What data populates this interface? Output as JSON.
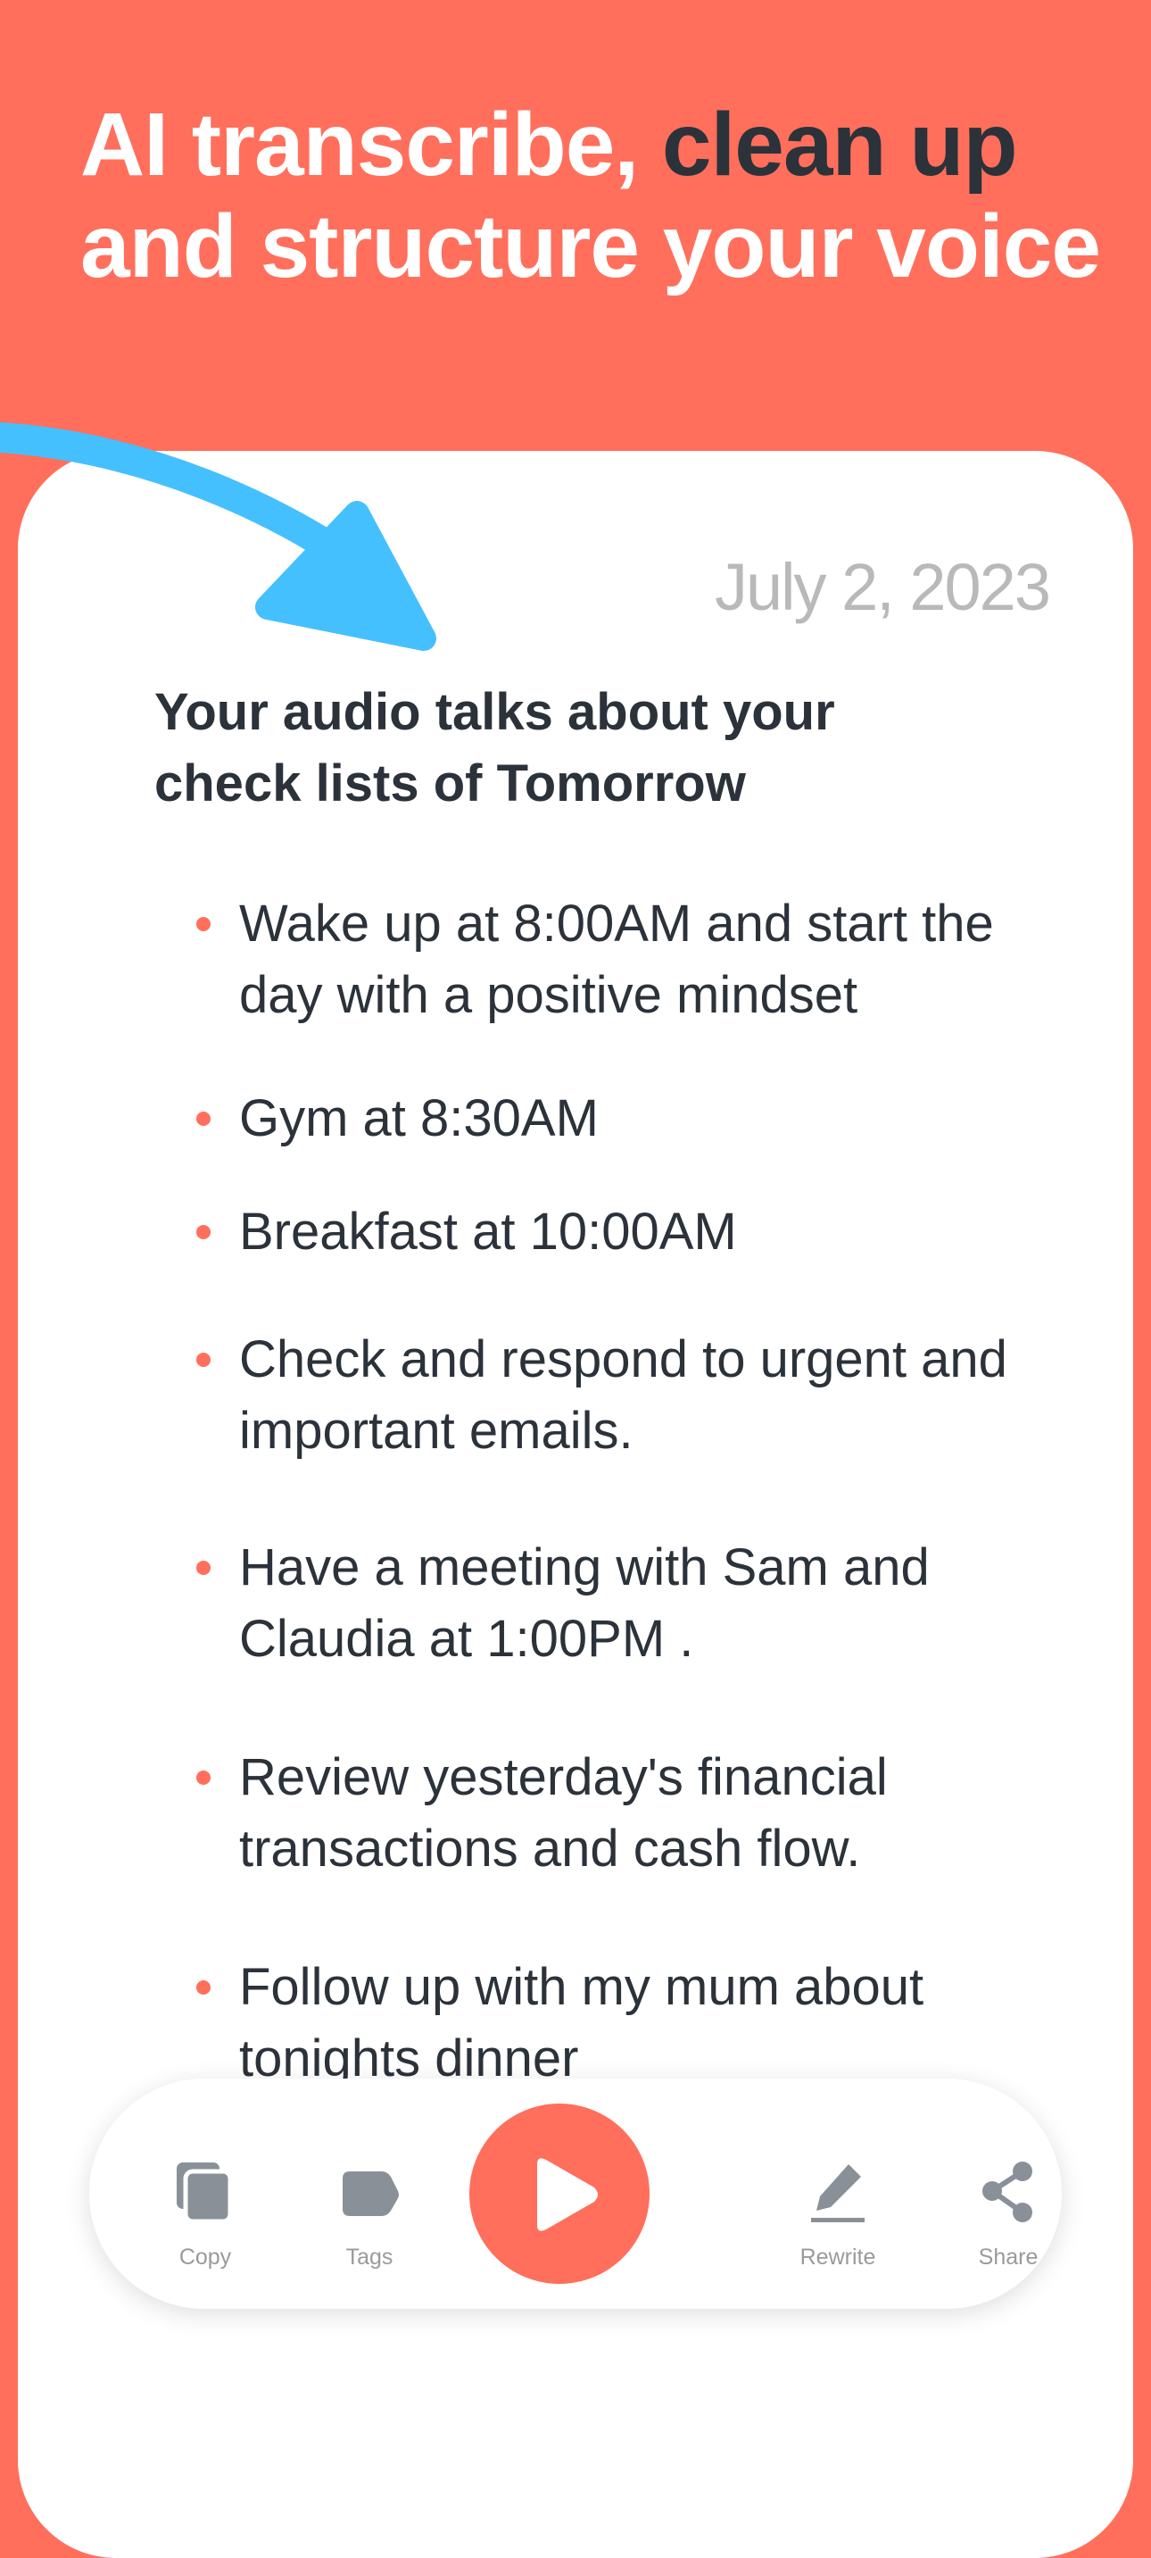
{
  "header": {
    "headline_part1": "AI transcribe, ",
    "headline_highlight": "clean up",
    "headline_part2": " and structure your voice"
  },
  "note": {
    "date": "July 2, 2023",
    "summary": "Your audio talks about your check lists of Tomorrow",
    "items": [
      "Wake up at 8:00AM and start the day with a positive mindset",
      "Gym at 8:30AM",
      "Breakfast at 10:00AM",
      "Check and respond to urgent and important emails.",
      "Have a meeting with Sam and Claudia at 1:00PM .",
      "Review yesterday's financial transactions and cash flow.",
      "Follow up with my mum about tonights dinner"
    ]
  },
  "toolbar": {
    "copy_label": "Copy",
    "tags_label": "Tags",
    "play_icon": "play-icon",
    "rewrite_label": "Rewrite",
    "share_label": "Share"
  },
  "colors": {
    "brand": "#ff6f5c",
    "arrow": "#45c0ff",
    "text_dark": "#2b323a",
    "date_gray": "#b9b9b9",
    "icon_gray": "#8a9097"
  }
}
